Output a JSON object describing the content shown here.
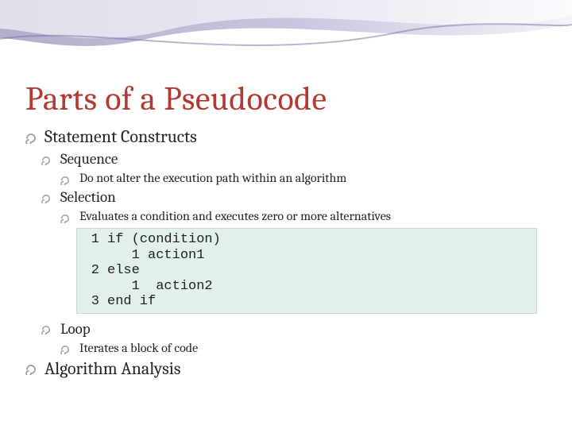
{
  "title": "Parts of a Pseudocode",
  "bullets": {
    "lvl1a": "Statement Constructs",
    "seq": "Sequence",
    "seq_detail": "Do not alter the execution path within an algorithm",
    "sel": "Selection",
    "sel_detail": "Evaluates a condition and executes zero or more alternatives",
    "loop": "Loop",
    "loop_detail": "Iterates a block of code",
    "lvl1b": "Algorithm Analysis"
  },
  "code": {
    "ln1": "1",
    "ln2": "2",
    "ln3": "3",
    "line1": "if (condition)",
    "line1b": "   1 action1",
    "line2": "else",
    "line2b": "   1  action2",
    "line3": "end if"
  }
}
